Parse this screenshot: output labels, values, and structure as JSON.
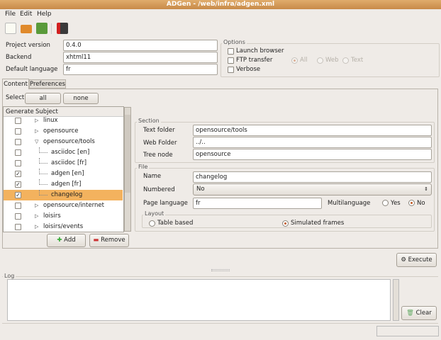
{
  "window": {
    "title": "ADGen - /web/infra/adgen.xml"
  },
  "menu": [
    "File",
    "Edit",
    "Help"
  ],
  "toolbar": [
    "new-icon",
    "open-icon",
    "save-icon",
    "quit-icon"
  ],
  "project": {
    "version_label": "Project version",
    "version": "0.4.0",
    "backend_label": "Backend",
    "backend": "xhtml11",
    "language_label": "Default language",
    "language": "fr"
  },
  "options": {
    "title": "Options",
    "launch_browser": "Launch browser",
    "launch_browser_checked": false,
    "ftp_transfer": "FTP transfer",
    "ftp_transfer_checked": false,
    "verbose": "Verbose",
    "verbose_checked": false,
    "radio_all": "All",
    "radio_web": "Web",
    "radio_text": "Text",
    "selected": "All"
  },
  "tabs": [
    "Content",
    "Preferences"
  ],
  "content": {
    "select_label": "Select",
    "all": "all",
    "none": "none",
    "col_generate": "Generate",
    "col_subject": "Subject",
    "rows": [
      {
        "label": "linux",
        "checked": false,
        "level": 0,
        "expander": "collapsed"
      },
      {
        "label": "opensource",
        "checked": false,
        "level": 0,
        "expander": "collapsed"
      },
      {
        "label": "opensource/tools",
        "checked": false,
        "level": 0,
        "expander": "expanded"
      },
      {
        "label": "asciidoc [en]",
        "checked": false,
        "level": 1
      },
      {
        "label": "asciidoc [fr]",
        "checked": false,
        "level": 1
      },
      {
        "label": "adgen [en]",
        "checked": true,
        "level": 1
      },
      {
        "label": "adgen [fr]",
        "checked": true,
        "level": 1
      },
      {
        "label": "changelog",
        "checked": true,
        "level": 1,
        "selected": true
      },
      {
        "label": "opensource/internet",
        "checked": false,
        "level": 0,
        "expander": "collapsed"
      },
      {
        "label": "loisirs",
        "checked": false,
        "level": 0,
        "expander": "collapsed"
      },
      {
        "label": "loisirs/events",
        "checked": false,
        "level": 0,
        "expander": "collapsed"
      }
    ],
    "add": "Add",
    "remove": "Remove"
  },
  "section": {
    "title": "Section",
    "text_folder_label": "Text folder",
    "text_folder": "opensource/tools",
    "web_folder_label": "Web Folder",
    "web_folder": "../..",
    "tree_node_label": "Tree node",
    "tree_node": "opensource"
  },
  "file": {
    "title": "File",
    "name_label": "Name",
    "name": "changelog",
    "numbered_label": "Numbered",
    "numbered": "No",
    "page_language_label": "Page language",
    "page_language": "fr",
    "multilanguage_label": "Multilanguage",
    "yes": "Yes",
    "no": "No",
    "multilanguage": "No",
    "layout_title": "Layout",
    "table_based": "Table based",
    "simulated_frames": "Simulated frames",
    "layout": "Simulated frames"
  },
  "execute": "Execute",
  "log": {
    "title": "Log",
    "text": "",
    "clear": "Clear"
  }
}
